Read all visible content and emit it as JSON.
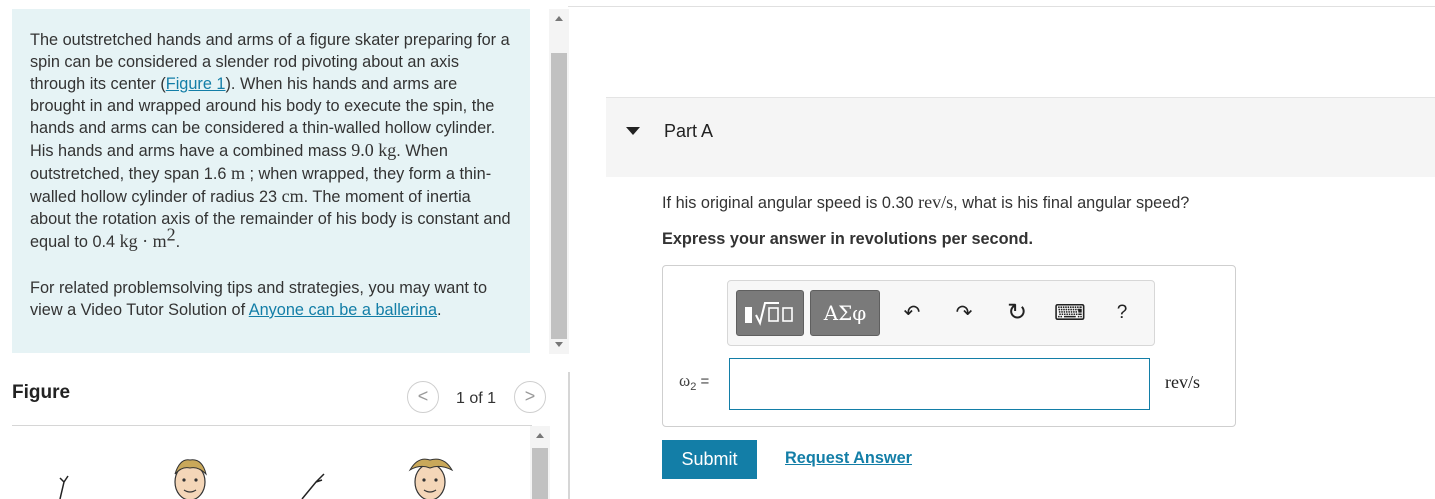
{
  "problem": {
    "p1_a": "The outstretched hands and arms of a figure skater preparing for a spin can be considered a slender rod pivoting about an axis through its center (",
    "figure_link": "Figure 1",
    "p1_b": "). When his hands and arms are brought in and wrapped around his body to execute the spin, the hands and arms can be considered a thin-walled hollow cylinder. His hands and arms have a combined mass ",
    "mass_num": "9.0",
    "mass_unit": "kg",
    "p1_c": ". When outstretched, they span ",
    "span_num": "1.6",
    "span_unit": "m",
    "p1_d": " ; when wrapped, they form a thin-walled hollow cylinder of radius ",
    "radius_num": "23",
    "radius_unit": "cm",
    "p1_e": ". The moment of inertia about the rotation axis of the remainder of his body is constant and equal to ",
    "inertia_num": "0.4",
    "inertia_unit": "kg · m",
    "inertia_exp": "2",
    "p1_f": ".",
    "tips_a": "For related problemsolving tips and strategies, you may want to view a Video Tutor Solution of ",
    "tips_link": "Anyone can be a ballerina",
    "tips_b": "."
  },
  "figure": {
    "label": "Figure",
    "prev": "<",
    "next": ">",
    "count": "1 of 1"
  },
  "part": {
    "title": "Part A",
    "question_a": "If his original angular speed is 0.30 ",
    "question_unit": "rev/s",
    "question_b": ", what is his final angular speed?",
    "instruction": "Express your answer in revolutions per second."
  },
  "toolbar": {
    "template_icon": "templates-icon",
    "symbols_label": "ΑΣφ",
    "undo": "↶",
    "redo": "↷",
    "reset": "↻",
    "keyboard": "⌨",
    "help": "?"
  },
  "answer": {
    "var_symbol": "ω",
    "var_sub": "2",
    "equals": "=",
    "value": "",
    "unit": "rev/s"
  },
  "actions": {
    "submit": "Submit",
    "request": "Request Answer"
  },
  "colors": {
    "accent": "#137ea7",
    "problem_bg": "#e6f3f5"
  }
}
